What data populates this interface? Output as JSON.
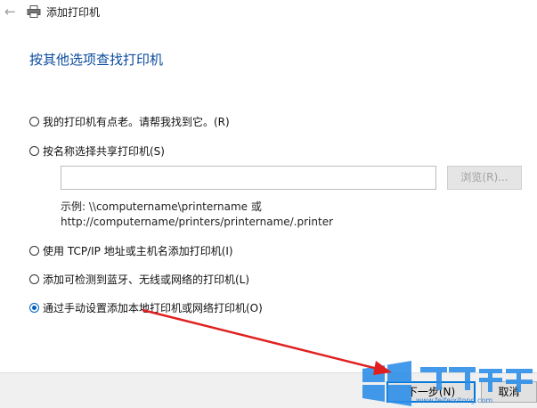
{
  "window": {
    "title": "添加打印机"
  },
  "heading": "按其他选项查找打印机",
  "options": [
    {
      "label": "我的打印机有点老。请帮我找到它。(R)",
      "checked": false
    },
    {
      "label": "按名称选择共享打印机(S)",
      "checked": false
    },
    {
      "label": "使用 TCP/IP 地址或主机名添加打印机(I)",
      "checked": false
    },
    {
      "label": "添加可检测到蓝牙、无线或网络的打印机(L)",
      "checked": false
    },
    {
      "label": "通过手动设置添加本地打印机或网络打印机(O)",
      "checked": true
    }
  ],
  "share": {
    "value": "",
    "browse_label": "浏览(R)...",
    "example_line1": "示例: \\\\computername\\printername 或",
    "example_line2": "http://computername/printers/printername/.printer"
  },
  "footer": {
    "next_label": "下一步(N)",
    "cancel_label": "取消"
  },
  "watermark": {
    "brand": "飞飞系统",
    "url": "www.feifeixitong.com"
  },
  "colors": {
    "accent": "#0078d7",
    "heading": "#0a4b9e",
    "arrow": "#e02020"
  }
}
